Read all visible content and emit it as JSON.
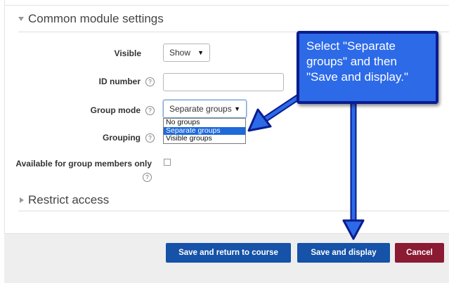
{
  "section_common": {
    "title": "Common module settings"
  },
  "fields": {
    "visible": {
      "label": "Visible",
      "value": "Show"
    },
    "id_number": {
      "label": "ID number",
      "value": ""
    },
    "group_mode": {
      "label": "Group mode",
      "value": "Separate groups",
      "options": [
        "No groups",
        "Separate groups",
        "Visible groups"
      ],
      "highlighted": "Separate groups"
    },
    "grouping": {
      "label": "Grouping"
    },
    "available_members": {
      "label": "Available for group members only",
      "checked": false
    }
  },
  "help_glyph": "?",
  "section_restrict": {
    "title": "Restrict access"
  },
  "buttons": {
    "save_return": "Save and return to course",
    "save_display": "Save and display",
    "cancel": "Cancel"
  },
  "callout": {
    "lines": [
      "Select \"Separate",
      "groups\" and then",
      "\"Save and display.\""
    ]
  },
  "colors": {
    "primary_button": "#1552a8",
    "cancel_button": "#8b1a33",
    "callout_fill": "#2c6ae8",
    "callout_border": "#0a1c8f",
    "dropdown_highlight": "#1e6ad9"
  }
}
